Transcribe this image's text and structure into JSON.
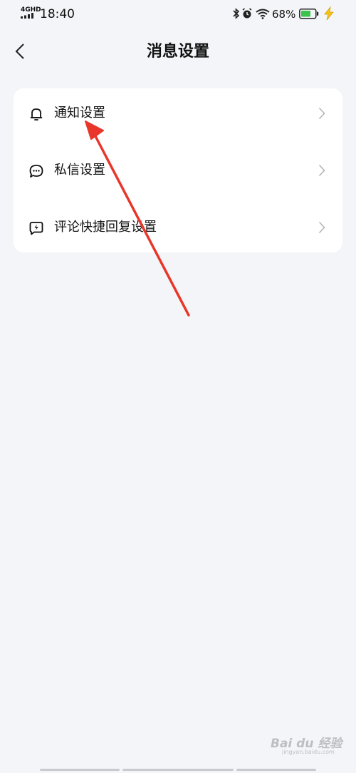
{
  "status_bar": {
    "network": "4GHD",
    "time": "18:40",
    "battery": "68%"
  },
  "header": {
    "title": "消息设置"
  },
  "settings": {
    "items": [
      {
        "label": "通知设置",
        "icon": "bell-icon"
      },
      {
        "label": "私信设置",
        "icon": "chat-bubble-icon"
      },
      {
        "label": "评论快捷回复设置",
        "icon": "quick-reply-icon"
      }
    ]
  },
  "watermark": {
    "brand": "Bai du 经验",
    "url": "jingyan.baidu.com"
  },
  "colors": {
    "background": "#f4f5f8",
    "card": "#ffffff",
    "annotation_arrow": "#e8362a",
    "battery_fill": "#3bc44b",
    "charging_bolt": "#f5c518"
  }
}
